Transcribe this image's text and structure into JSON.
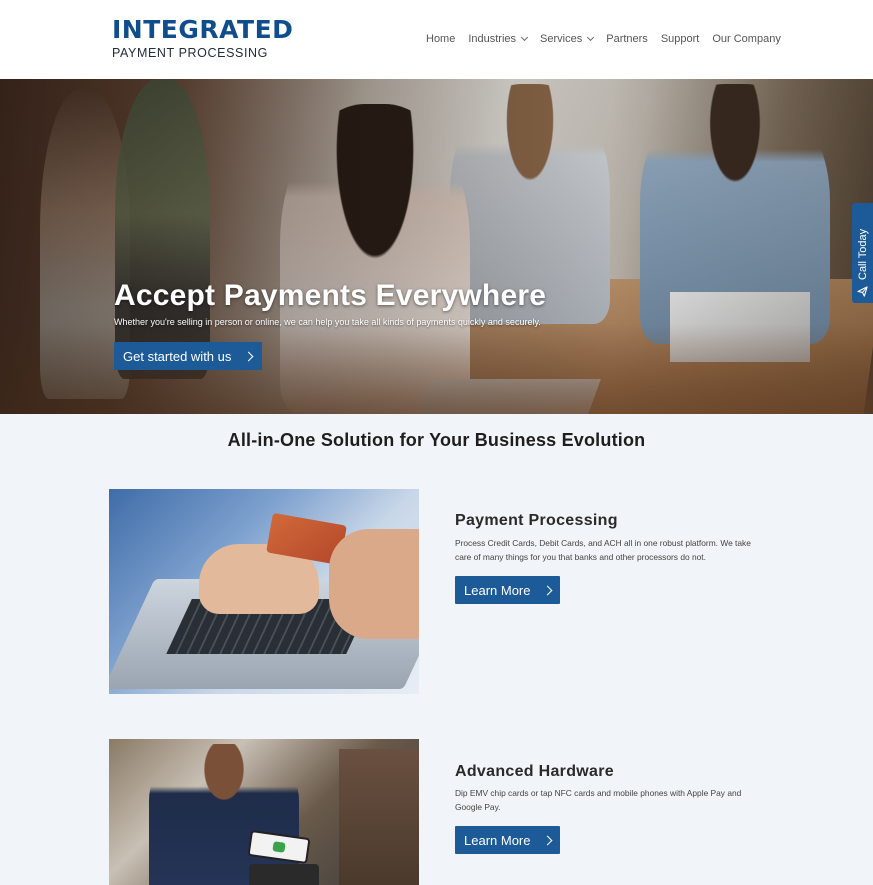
{
  "header": {
    "logo_main": "INTEGRATED",
    "logo_sub": "PAYMENT PROCESSING",
    "nav": [
      {
        "label": "Home",
        "has_dropdown": false
      },
      {
        "label": "Industries",
        "has_dropdown": true
      },
      {
        "label": "Services",
        "has_dropdown": true
      },
      {
        "label": "Partners",
        "has_dropdown": false
      },
      {
        "label": "Support",
        "has_dropdown": false
      },
      {
        "label": "Our Company",
        "has_dropdown": false
      }
    ]
  },
  "hero": {
    "title": "Accept Payments Everywhere",
    "subtitle": "Whether you're selling in person or online, we can help you take all kinds of payments quickly and securely.",
    "cta_label": "Get started with us"
  },
  "side_tab": {
    "label": "Call Today",
    "icon": "paper-plane-icon"
  },
  "section": {
    "title": "All-in-One Solution for Your Business Evolution"
  },
  "features": [
    {
      "title": "Payment Processing",
      "description": "Process Credit Cards, Debit Cards, and ACH all in one robust platform. We take care of many things for you that banks and other processors do not.",
      "button_label": "Learn More"
    },
    {
      "title": "Advanced Hardware",
      "description": "Dip EMV chip cards or tap NFC cards and mobile phones with Apple Pay and Google Pay.",
      "button_label": "Learn More"
    }
  ],
  "colors": {
    "brand_blue": "#1c5a98",
    "logo_blue": "#0f4d8c",
    "page_background": "#f1f4f8"
  }
}
